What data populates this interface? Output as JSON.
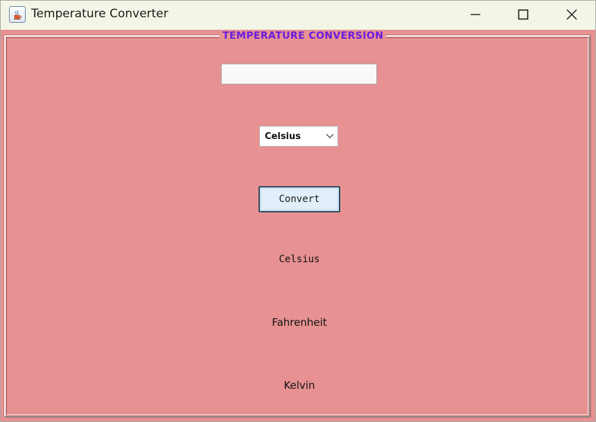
{
  "window": {
    "title": "Temperature Converter",
    "icon": "java-cup-icon",
    "controls": [
      "minimize-icon",
      "maximize-icon",
      "close-icon"
    ]
  },
  "form": {
    "group_title": "TEMPERATURE CONVERSION",
    "input_value": "",
    "unit_select": {
      "selected": "Celsius"
    },
    "convert_label": "Convert"
  },
  "results": {
    "celsius": "Celsius",
    "fahrenheit": "Fahrenheit",
    "kelvin": "Kelvin"
  },
  "colors": {
    "background": "#e79192",
    "titlebar": "#f3f6e6",
    "group_title": "#6a1ce0",
    "button_face": "#e2eef9",
    "button_border": "#2b4a5e"
  }
}
